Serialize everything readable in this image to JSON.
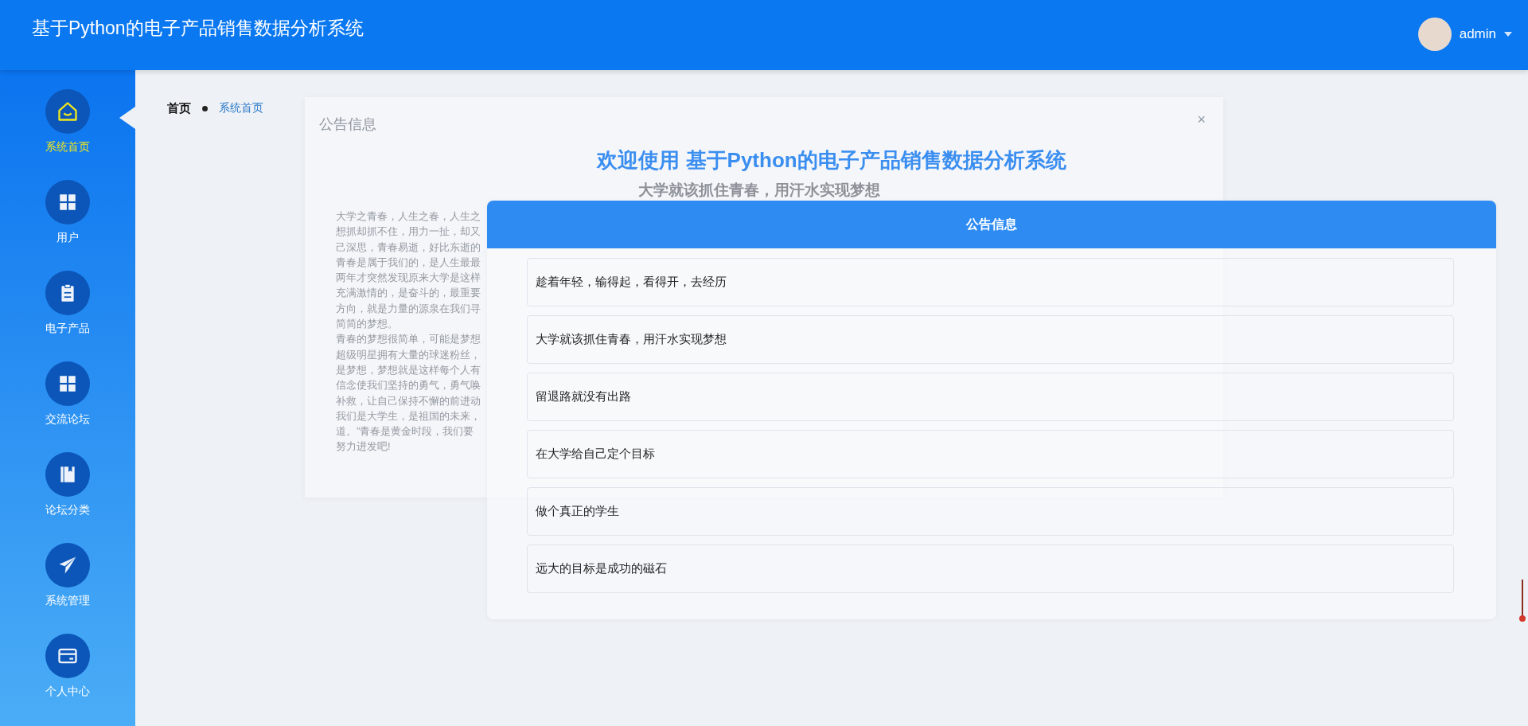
{
  "header": {
    "title": "基于Python的电子产品销售数据分析系统",
    "user": "admin"
  },
  "sidebar": {
    "items": [
      {
        "label": "系统首页",
        "selected": true
      },
      {
        "label": "用户",
        "selected": false
      },
      {
        "label": "电子产品",
        "selected": false
      },
      {
        "label": "交流论坛",
        "selected": false
      },
      {
        "label": "论坛分类",
        "selected": false
      },
      {
        "label": "系统管理",
        "selected": false
      },
      {
        "label": "个人中心",
        "selected": false
      }
    ]
  },
  "breadcrumb": [
    {
      "label": "首页"
    },
    {
      "label": "系统首页"
    }
  ],
  "welcome_title": "欢迎使用 基于Python的电子产品销售数据分析系统",
  "notice_dialog": {
    "title": "公告信息",
    "close": "×",
    "heading": "大学就该抓住青春，用汗水实现梦想",
    "body_lines": [
      "大学之青春，人生之春，人生之",
      "想抓却抓不住，用力一扯，却又",
      "己深思，青春易逝，好比东逝的",
      "青春是属于我们的，是人生最最",
      "两年才突然发现原来大学是这样",
      "充满激情的，是奋斗的，最重要",
      "方向，就是力量的源泉在我们寻",
      "简简的梦想。",
      "青春的梦想很简单，可能是梦想",
      "超级明星拥有大量的球迷粉丝，",
      "是梦想，梦想就是这样每个人有",
      "信念使我们坚持的勇气，勇气唤",
      "补救，让自己保持不懈的前进动",
      "我们是大学生，是祖国的未来，",
      "道。”青春是黄金时段，我们要",
      "努力进发吧!"
    ]
  },
  "notice_panel": {
    "title": "公告信息",
    "items": [
      "趁着年轻，输得起，看得开，去经历",
      "大学就该抓住青春，用汗水实现梦想",
      "留退路就没有出路",
      "在大学给自己定个目标",
      "做个真正的学生",
      "远大的目标是成功的磁石"
    ]
  }
}
